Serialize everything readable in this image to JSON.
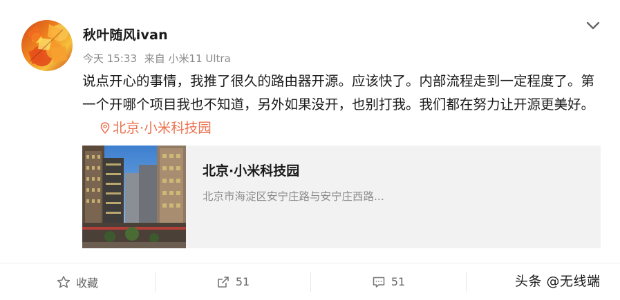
{
  "post": {
    "username": "秋叶随风ivan",
    "time": "今天 15:33",
    "source": "来自 小米11 Ultra",
    "text": "说点开心的事情，我推了很久的路由器开源。应该快了。内部流程走到一定程度了。第一个开哪个项目我也不知道，另外如果没开，也别打我。我们都在努力让开源更美好。",
    "location_tag": "北京·小米科技园"
  },
  "location_card": {
    "title": "北京·小米科技园",
    "address": "北京市海淀区安宁庄路与安宁庄西路..."
  },
  "actions": {
    "favorite_label": "收藏",
    "repost_count": "51",
    "comment_count": "51"
  },
  "watermark": "头条 @无线端",
  "icons": {
    "menu": "chevron-down-icon",
    "location": "location-pin-icon",
    "favorite": "star-icon",
    "repost": "repost-icon",
    "comment": "comment-icon"
  },
  "colors": {
    "accent": "#eb7350",
    "text": "#1a1a1a",
    "muted": "#8a8a8a",
    "card_bg": "#f2f2f2"
  }
}
